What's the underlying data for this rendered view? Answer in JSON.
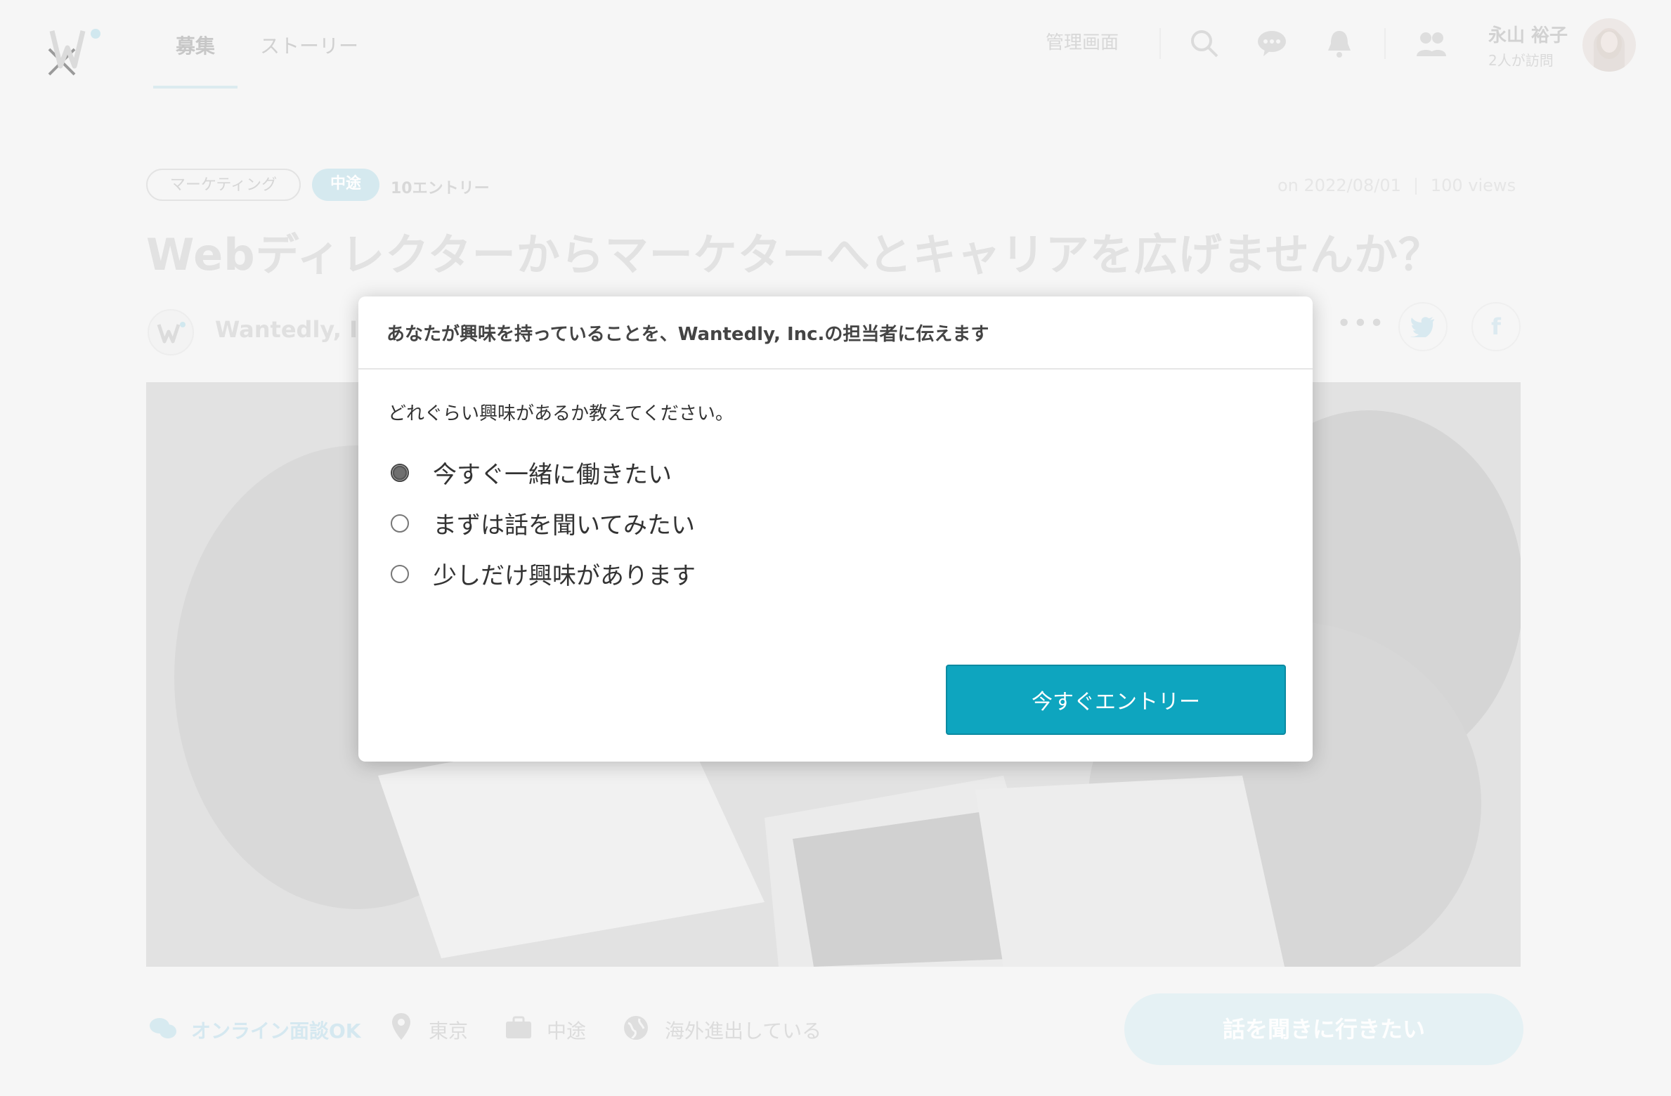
{
  "nav": {
    "tab_recruit": "募集",
    "tab_story": "ストーリー",
    "admin_link": "管理画面"
  },
  "user": {
    "name": "永山 裕子",
    "visits": "2人が訪問"
  },
  "job": {
    "tag_category": "マーケティング",
    "tag_type": "中途",
    "entries": "10エントリー",
    "posted_on": "on 2022/08/01",
    "views": "100 views",
    "title": "Webディレクターからマーケターへとキャリアを広げませんか？",
    "company": "Wantedly, Inc."
  },
  "features": {
    "online_interview": "オンライン面談OK",
    "location": "東京",
    "employment": "中途",
    "overseas": "海外進出している"
  },
  "cta": {
    "label": "話を聞きに行きたい"
  },
  "modal": {
    "header": "あなたが興味を持っていることを、Wantedly, Inc.の担当者に伝えます",
    "prompt": "どれぐらい興味があるか教えてください。",
    "options": [
      {
        "label": "今すぐ一緒に働きたい",
        "checked": true
      },
      {
        "label": "まずは話を聞いてみたい",
        "checked": false
      },
      {
        "label": "少しだけ興味があります",
        "checked": false
      }
    ],
    "submit_label": "今すぐエントリー"
  },
  "colors": {
    "accent": "#0ea5bf",
    "background": "#f6f6f6"
  },
  "icons": [
    "close-icon",
    "wantedly-logo-icon",
    "search-icon",
    "chat-icon",
    "bell-icon",
    "people-icon",
    "twitter-icon",
    "facebook-icon",
    "chat-bubbles-icon",
    "location-pin-icon",
    "briefcase-icon",
    "globe-icon"
  ]
}
